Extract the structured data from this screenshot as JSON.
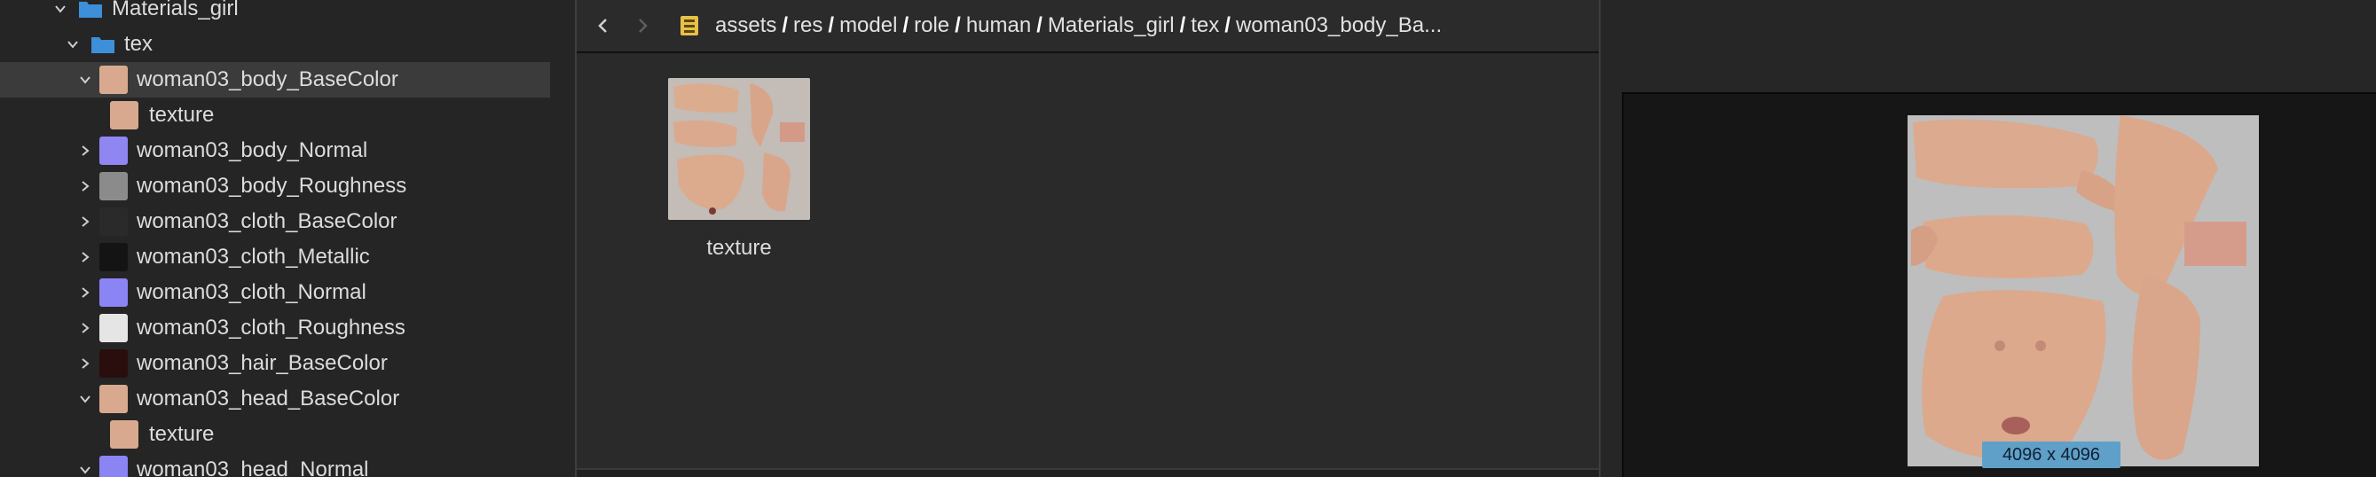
{
  "tree": {
    "root_folder": "Materials_girl",
    "tex_folder": "tex",
    "items": [
      {
        "label": "woman03_body_BaseColor",
        "expanded": true,
        "selected": true,
        "color": "#d9a98f"
      },
      {
        "label": "texture",
        "child": true,
        "color": "#d9a98f"
      },
      {
        "label": "woman03_body_Normal",
        "expanded": false,
        "color": "#8f86f2"
      },
      {
        "label": "woman03_body_Roughness",
        "expanded": false,
        "color": "#8b8b8b"
      },
      {
        "label": "woman03_cloth_BaseColor",
        "expanded": false,
        "color": "#2a2a2a"
      },
      {
        "label": "woman03_cloth_Metallic",
        "expanded": false,
        "color": "#141414"
      },
      {
        "label": "woman03_cloth_Normal",
        "expanded": false,
        "color": "#8b84f4"
      },
      {
        "label": "woman03_cloth_Roughness",
        "expanded": false,
        "color": "#e5e5e5"
      },
      {
        "label": "woman03_hair_BaseColor",
        "expanded": false,
        "color": "#2a0d0d"
      },
      {
        "label": "woman03_head_BaseColor",
        "expanded": true,
        "color": "#d8a98e"
      },
      {
        "label": "texture",
        "child": true,
        "color": "#d8a98e"
      },
      {
        "label": "woman03_head_Normal",
        "expanded": true,
        "color": "#8a85f3"
      }
    ]
  },
  "pathbar": {
    "crumbs": [
      "assets",
      "res",
      "model",
      "role",
      "human",
      "Materials_girl",
      "tex",
      "woman03_body_Ba..."
    ],
    "separator": "/"
  },
  "asset": {
    "label": "texture"
  },
  "preview": {
    "size_label": "4096 x 4096"
  }
}
